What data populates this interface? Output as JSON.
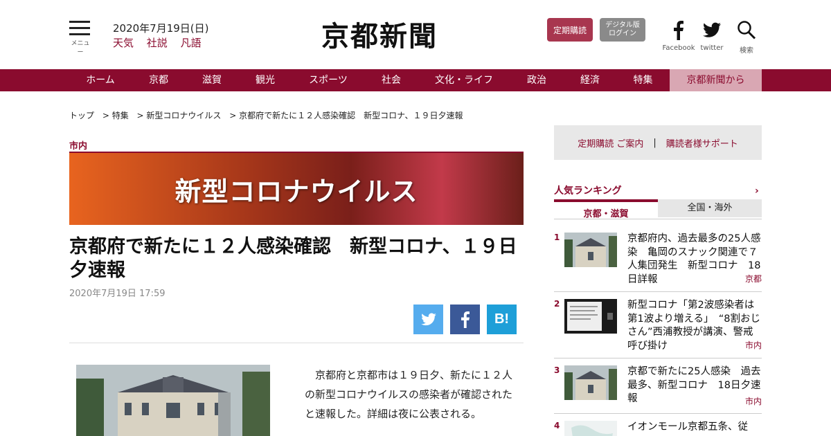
{
  "header": {
    "menu_label": "メニュー",
    "date": "2020年7月19日(日)",
    "links": [
      "天気",
      "社説",
      "凡語"
    ],
    "logo": "京都新聞",
    "subscribe_label": "定期購読",
    "digital_line1": "デジタル版",
    "digital_line2": "ログイン",
    "facebook_label": "Facebook",
    "twitter_label": "twitter",
    "search_label": "検索"
  },
  "nav": {
    "items": [
      "ホーム",
      "京都",
      "滋賀",
      "観光",
      "スポーツ",
      "社会",
      "文化・ライフ",
      "政治",
      "経済",
      "特集",
      "京都新聞から"
    ]
  },
  "breadcrumb": [
    "トップ",
    "> 特集",
    "> 新型コロナウイルス",
    "> 京都府で新たに１２人感染確認　新型コロナ、１９日夕速報"
  ],
  "article": {
    "category": "市内",
    "banner_text": "新型コロナウイルス",
    "headline": "京都府で新たに１２人感染確認　新型コロナ、１９日夕速報",
    "date": "2020年7月19日 17:59",
    "body": "　京都府と京都市は１９日夕、新たに１２人の新型コロナウイルスの感染者が確認されたと速報した。詳細は夜に公表される。",
    "share_hatena": "B!"
  },
  "sidebar": {
    "sub_link1": "定期購読 ご案内",
    "sub_sep": "|",
    "sub_link2": "購読者様サポート",
    "ranking_title": "人気ランキング",
    "ranking_arrow": "›",
    "tab_active": "京都・滋賀",
    "tab_other": "全国・海外",
    "items": [
      {
        "num": "1",
        "text": "京都府内、過去最多の25人感染　亀岡のスナック関連で７人集団発生　新型コロナ　18日詳報",
        "tag": "京都"
      },
      {
        "num": "2",
        "text": "新型コロナ「第2波感染者は第1波より増える」　“8割おじさん”西浦教授が講演、警戒呼び掛け",
        "tag": "市内"
      },
      {
        "num": "3",
        "text": "京都で新たに25人感染　過去最多、新型コロナ　18日夕速報",
        "tag": "市内"
      },
      {
        "num": "4",
        "text": "イオンモール京都五条、従",
        "tag": ""
      }
    ]
  },
  "colors": {
    "brand": "#8a0b2e",
    "twitter": "#55acee",
    "facebook": "#3b5998",
    "hatena": "#1e9fd8"
  }
}
